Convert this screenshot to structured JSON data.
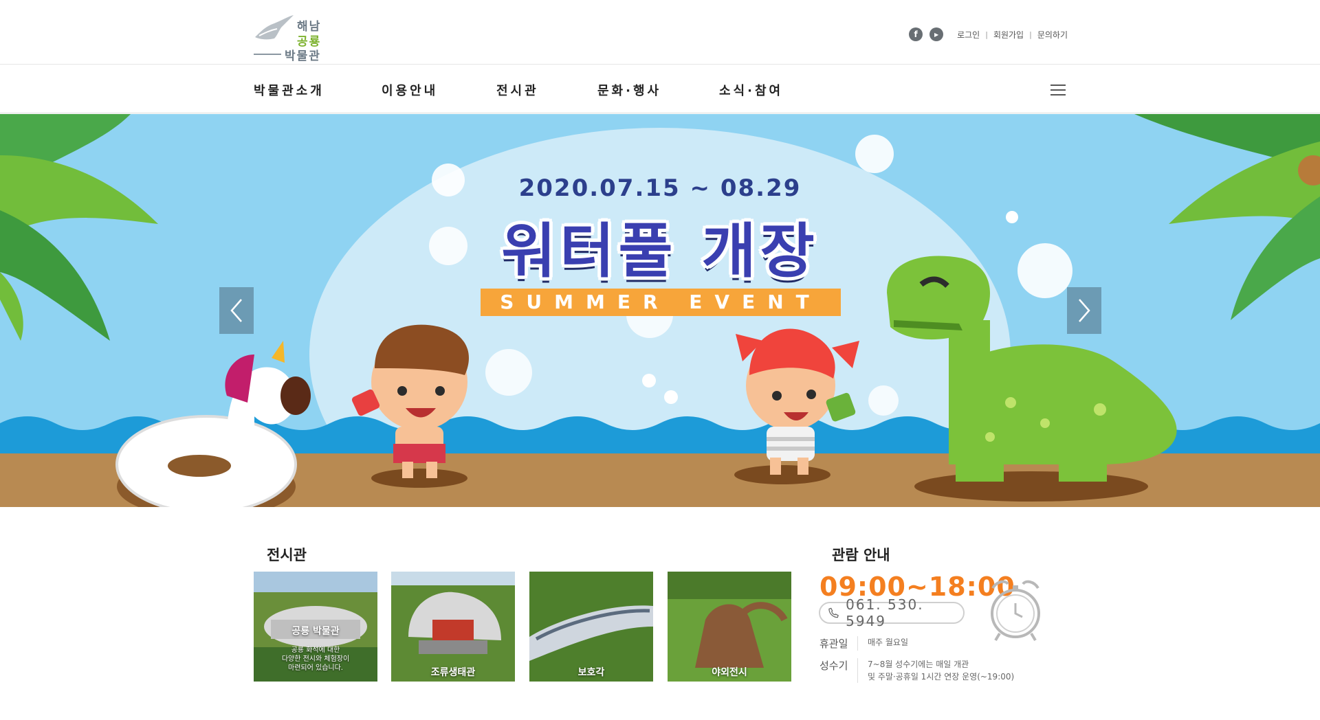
{
  "header": {
    "logo": {
      "line1": "해남",
      "line2": "공룡",
      "line3": "박물관"
    },
    "sns": [
      {
        "icon": "facebook-icon",
        "glyph": "f"
      },
      {
        "icon": "youtube-icon",
        "glyph": "▶"
      }
    ],
    "links": [
      "로그인",
      "회원가입",
      "문의하기"
    ],
    "separator": "|"
  },
  "nav": {
    "items": [
      "박물관소개",
      "이용안내",
      "전시관",
      "문화·행사",
      "소식·참여"
    ],
    "menu_icon": "hamburger-menu-icon"
  },
  "hero": {
    "date": "2020.07.15 ~ 08.29",
    "title": "워터풀 개장",
    "subtitle": "SUMMER EVENT",
    "prev_icon": "chevron-left-icon",
    "next_icon": "chevron-right-icon"
  },
  "exhibit": {
    "title": "전시관",
    "cards": [
      {
        "label": "공룡 박물관",
        "desc1": "공룡 화석에 대한",
        "desc2": "다양한 전시와 체험장이",
        "desc3": "마련되어 있습니다."
      },
      {
        "label": "조류생태관"
      },
      {
        "label": "보호각"
      },
      {
        "label": "야외전시"
      }
    ]
  },
  "visit": {
    "title": "관람 안내",
    "hours": "09:00~18:00",
    "phone": "061. 530. 5949",
    "closed_label": "휴관일",
    "closed_value": "매주 월요일",
    "peak_label": "성수기",
    "peak_value1": "7~8월 성수기에는 매일 개관",
    "peak_value2": "및 주말·공휴일 1시간 연장 운영(~19:00)",
    "clock_icon": "alarm-clock-icon"
  },
  "colors": {
    "accent": "#f47f20",
    "nav_text": "#222222",
    "title_blue": "#3a3fb0",
    "event_orange": "#f7a53a",
    "logo_green": "#7db22f"
  }
}
